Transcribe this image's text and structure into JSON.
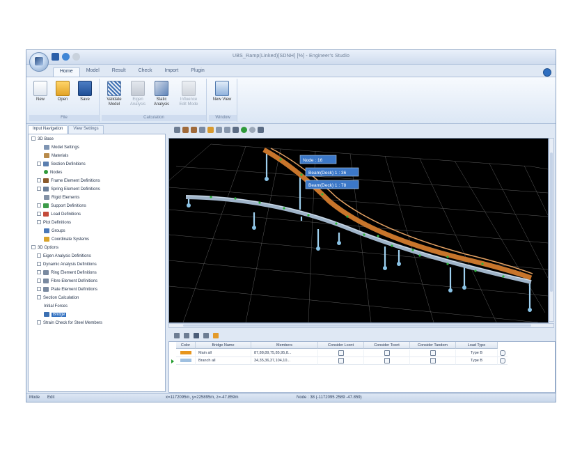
{
  "window": {
    "title": "UBS_Ramp(Linked)[SDNH] [%] - Engineer's Studio"
  },
  "ribbon": {
    "tabs": [
      "Home",
      "Model",
      "Result",
      "Check",
      "Import",
      "Plugin"
    ],
    "active_tab": "Home",
    "groups": [
      {
        "label": "File",
        "buttons": [
          "New",
          "Open",
          "Save"
        ]
      },
      {
        "label": "Calculation",
        "buttons": [
          "Validate Model",
          "Eigen Analysis",
          "Static Analysis",
          "Influence Edit Mode"
        ]
      },
      {
        "label": "Window",
        "buttons": [
          "New View"
        ]
      }
    ]
  },
  "nav": {
    "tabs": [
      "Input Navigation",
      "View Settings"
    ]
  },
  "tree": {
    "items": [
      {
        "label": "3D Base",
        "level": 0
      },
      {
        "label": "Model Settings",
        "level": 1
      },
      {
        "label": "Materials",
        "level": 1
      },
      {
        "label": "Section Definitions",
        "level": 1
      },
      {
        "label": "Nodes",
        "level": 1
      },
      {
        "label": "Frame Element Definitions",
        "level": 1
      },
      {
        "label": "Spring Element Definitions",
        "level": 1
      },
      {
        "label": "Rigid Elements",
        "level": 1
      },
      {
        "label": "Support Definitions",
        "level": 1
      },
      {
        "label": "Load Definitions",
        "level": 1
      },
      {
        "label": "Plot Definitions",
        "level": 1
      },
      {
        "label": "Groups",
        "level": 1
      },
      {
        "label": "Coordinate Systems",
        "level": 1
      },
      {
        "label": "3D Options",
        "level": 0
      },
      {
        "label": "Eigen Analysis Definitions",
        "level": 1
      },
      {
        "label": "Dynamic Analysis Definitions",
        "level": 1
      },
      {
        "label": "Ring Element Definitions",
        "level": 1
      },
      {
        "label": "Fibre Element Definitions",
        "level": 1
      },
      {
        "label": "Plate Element Definitions",
        "level": 1
      },
      {
        "label": "Section Calculation",
        "level": 1
      },
      {
        "label": "Initial Forces",
        "level": 1
      },
      {
        "label": "Bridge",
        "level": 1,
        "selected": true
      },
      {
        "label": "Strain Check for Steel Members",
        "level": 1
      }
    ]
  },
  "viewport": {
    "labels": [
      "Node : 16",
      "Beam(Deck) 1 : 36",
      "Beam(Deck) 1 : 78"
    ]
  },
  "grid": {
    "columns": [
      "Color",
      "Bridge Name",
      "Members",
      "Consider Lcont",
      "Consider Tcont",
      "Consider Tandem",
      "Load Type"
    ],
    "rows": [
      {
        "color": "#e7951c",
        "name": "Main all",
        "members": "87,88,89,75,85,95,8...",
        "load_type": "Type B"
      },
      {
        "color": "#9fc0e0",
        "name": "Branch all",
        "members": "34,35,36,37,104,10...",
        "load_type": "Type B"
      }
    ]
  },
  "status": {
    "mode_label": "Mode",
    "mode_value": "Edit",
    "coords": "x=1172095m, y=225895m, z=-47.859m",
    "node_info": "Node : 38 (-1172095 2589 -47.859)"
  },
  "colors": {
    "accent": "#2f6fc0",
    "main_deck": "#c8752b",
    "branch_deck": "#9fb4c9",
    "pier": "#9fd0ef",
    "viewport_bg": "#000000"
  }
}
